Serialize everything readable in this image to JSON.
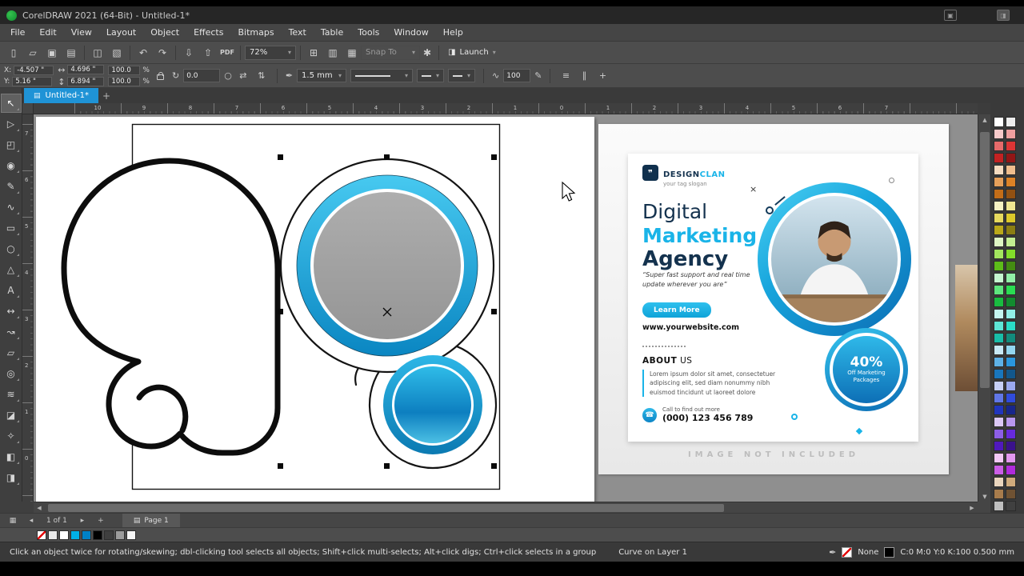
{
  "window": {
    "title": "CorelDRAW 2021 (64-Bit) - Untitled-1*"
  },
  "menu": {
    "items": [
      "File",
      "Edit",
      "View",
      "Layout",
      "Object",
      "Effects",
      "Bitmaps",
      "Text",
      "Table",
      "Tools",
      "Window",
      "Help"
    ]
  },
  "toolbar": {
    "zoom_value": "72%",
    "snap_label": "Snap To",
    "launch_label": "Launch",
    "groups": [
      [
        {
          "name": "new-document-button",
          "glyph": "▯"
        },
        {
          "name": "open-button",
          "glyph": "▱"
        },
        {
          "name": "save-button",
          "glyph": "▣"
        },
        {
          "name": "print-button",
          "glyph": "▤"
        }
      ],
      [
        {
          "name": "copy-button",
          "glyph": "◫"
        },
        {
          "name": "paste-button",
          "glyph": "▧"
        }
      ],
      [
        {
          "name": "undo-button",
          "glyph": "↶"
        },
        {
          "name": "redo-button",
          "glyph": "↷"
        }
      ],
      [
        {
          "name": "import-button",
          "glyph": "⇩"
        },
        {
          "name": "export-button",
          "glyph": "⇧"
        },
        {
          "name": "pdf-button",
          "glyph": "PDF"
        }
      ]
    ],
    "right_buttons": [
      {
        "name": "fullscreen-preview-button",
        "glyph": "⊞"
      },
      {
        "name": "show-rulers-button",
        "glyph": "▥"
      },
      {
        "name": "show-grid-button",
        "glyph": "▦"
      }
    ]
  },
  "property_bar": {
    "x_label": "X:",
    "x_value": "-4.507 \"",
    "y_label": "Y:",
    "y_value": "5.16 \"",
    "width_value": "4.696 \"",
    "height_value": "6.894 \"",
    "scale_x": "100.0",
    "scale_y": "100.0",
    "percent": "%",
    "angle_value": "0.0",
    "outline_width": "1.5 mm",
    "smoothing_value": "100"
  },
  "document_tabs": {
    "active_tab": "Untitled-1*",
    "units": "inches"
  },
  "rulers": {
    "h_numbers": [
      "10",
      "9",
      "8",
      "7",
      "6",
      "5",
      "4",
      "3",
      "2",
      "1",
      "0",
      "1",
      "2",
      "3",
      "4",
      "5",
      "6",
      "7"
    ],
    "v_numbers": [
      "7",
      "6",
      "5",
      "4",
      "3",
      "2",
      "1",
      "0"
    ]
  },
  "toolbox": {
    "tools": [
      {
        "name": "pick-tool",
        "glyph": "↖",
        "active": true
      },
      {
        "name": "shape-tool",
        "glyph": "▷"
      },
      {
        "name": "crop-tool",
        "glyph": "◰"
      },
      {
        "name": "zoom-tool",
        "glyph": "◉"
      },
      {
        "name": "freehand-tool",
        "glyph": "✎"
      },
      {
        "name": "artistic-media-tool",
        "glyph": "∿"
      },
      {
        "name": "rectangle-tool",
        "glyph": "▭"
      },
      {
        "name": "ellipse-tool",
        "glyph": "○"
      },
      {
        "name": "polygon-tool",
        "glyph": "△"
      },
      {
        "name": "text-tool",
        "glyph": "A"
      },
      {
        "name": "parallel-dimension-tool",
        "glyph": "↔"
      },
      {
        "name": "connector-tool",
        "glyph": "↝"
      },
      {
        "name": "drop-shadow-tool",
        "glyph": "▱"
      },
      {
        "name": "contour-tool",
        "glyph": "◎"
      },
      {
        "name": "blend-tool",
        "glyph": "≋"
      },
      {
        "name": "transparency-tool",
        "glyph": "◪"
      },
      {
        "name": "color-eyedropper-tool",
        "glyph": "✧"
      },
      {
        "name": "interactive-fill-tool",
        "glyph": "◧"
      },
      {
        "name": "smart-fill-tool",
        "glyph": "◨"
      }
    ]
  },
  "palette": {
    "colors": [
      "#ffffff",
      "#ededed",
      "#f6c9c9",
      "#ef9f9f",
      "#e66a6a",
      "#dc3535",
      "#c32222",
      "#921616",
      "#f6dcc0",
      "#efbd8d",
      "#e6a05a",
      "#dc8226",
      "#c36d18",
      "#925112",
      "#f6f2c3",
      "#efe691",
      "#e6d95e",
      "#dcc92a",
      "#baa91a",
      "#8b7e13",
      "#def6c3",
      "#c3ef91",
      "#a3e65e",
      "#82dc2a",
      "#5dbd19",
      "#448b12",
      "#c5f6cf",
      "#91efa7",
      "#5ee67e",
      "#2adc52",
      "#19bd40",
      "#128b2f",
      "#c5f6f0",
      "#91efe6",
      "#5ee6d6",
      "#2adcc6",
      "#19bda8",
      "#128b7c",
      "#c7e9f6",
      "#93d6ef",
      "#5eb1e6",
      "#2a96dc",
      "#1976bd",
      "#12578b",
      "#c7d0f6",
      "#9aa9ef",
      "#6177e6",
      "#304bdc",
      "#2135bd",
      "#18268b",
      "#dbc7f6",
      "#b897ef",
      "#8d5ee6",
      "#672adc",
      "#5019bd",
      "#3a128b",
      "#f2c7f6",
      "#e297ef",
      "#cb5ee6",
      "#b02adc",
      "#e9d5bd",
      "#cfab7c",
      "#a87c4c",
      "#6f5233",
      "#bfbfbf",
      "#404040"
    ]
  },
  "doc_palette": {
    "colors": [
      "none",
      "#e8e8e8",
      "#ffffff",
      "#00b0e6",
      "#0081c6",
      "#000000",
      "#3f3f3f",
      "#9c9c9c",
      "#f5f5f5"
    ]
  },
  "page_nav": {
    "page_info": "1 of 1",
    "page_tab": "Page 1"
  },
  "status_bar": {
    "hint": "Click an object twice for rotating/skewing; dbl-clicking tool selects all objects; Shift+click multi-selects; Alt+click digs; Ctrl+click selects in a group",
    "object_info": "Curve on Layer 1",
    "fill_label": "None",
    "outline_label": "C:0 M:0 Y:0 K:100 0.500 mm"
  },
  "reference": {
    "logo_name_1": "DESIGN",
    "logo_name_2": "CLAN",
    "logo_tagline": "your tag slogan",
    "heading_line1": "Digital",
    "heading_line2": "Marketing",
    "heading_line3": "Agency",
    "quote": "“Super fast support and real time update wherever you are”",
    "cta_label": "Learn More",
    "website": "www.yourwebsite.com",
    "about_heading_1": "ABOUT",
    "about_heading_2": " US",
    "about_text": "Lorem ipsum dolor sit amet, consectetuer adipiscing elit, sed diam nonummy nibh euismod tincidunt ut laoreet dolore",
    "call_label": "Call to find out more",
    "phone_number": "(000) 123 456 789",
    "badge_percent": "40%",
    "badge_line1": "Off Marketing",
    "badge_line2": "Packages",
    "footer_note": "IMAGE NOT INCLUDED",
    "close_mark": "×"
  },
  "icons": {
    "dropdown": "▾",
    "launch": "◨",
    "gear": "✱",
    "size_h": "↔",
    "size_v": "↕",
    "rotate": "↻",
    "rotate_center": "○",
    "mirror_h": "⇄",
    "mirror_v": "⇅",
    "outline_pen": "✒",
    "smooth": "∿",
    "pressure": "✎",
    "bar_menu": "≡",
    "bar_split": "∥",
    "bar_plus": "+",
    "tab_doc": "▤",
    "tab_plus": "+",
    "scroll_up": "▲",
    "scroll_down": "▼",
    "scroll_left": "◀",
    "scroll_right": "▶",
    "page_sorter": "▦",
    "nav_prev": "◂",
    "nav_next": "▸",
    "nav_plus": "+",
    "page_icon": "▤",
    "phone": "☎",
    "logo_glyph": "❞",
    "status_pen": "✒",
    "winicon_1": "▣",
    "winicon_2": "◨"
  },
  "colors": {
    "accent_cyan": "#1ab4e8",
    "tab_blue": "#1f93d6",
    "heading_navy": "#14324e",
    "canvas_gray": "#8f8f8f"
  }
}
